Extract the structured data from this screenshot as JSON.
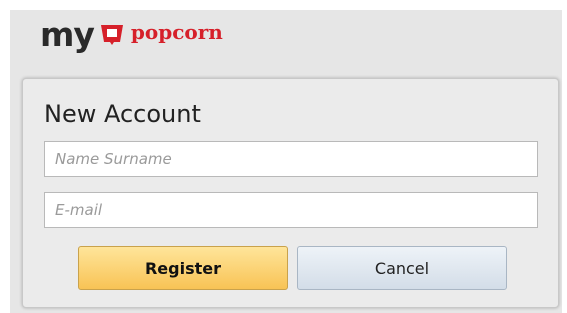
{
  "logo": {
    "my": "my",
    "popcorn": "popcorn"
  },
  "form": {
    "title": "New Account",
    "name_placeholder": "Name Surname",
    "email_placeholder": "E-mail",
    "register_label": "Register",
    "cancel_label": "Cancel"
  },
  "colors": {
    "brand_red": "#d6202a",
    "register_bg": "#f8c355",
    "cancel_bg": "#d3dde8"
  },
  "icons": {
    "logo_icon": "popcorn-box-icon"
  }
}
